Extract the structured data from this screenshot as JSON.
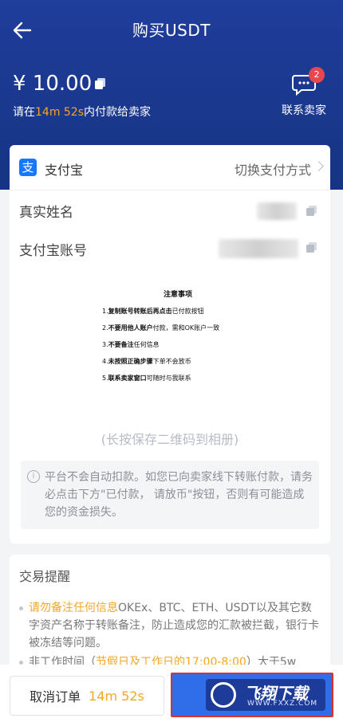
{
  "header": {
    "title": "购买USDT",
    "price": "¥ 10.00",
    "pay_tip_prefix": "请在",
    "pay_tip_time": "14m 52s",
    "pay_tip_suffix": "内付款给卖家",
    "contact_label": "联系卖家",
    "contact_badge": "2"
  },
  "payment": {
    "method_icon_text": "支",
    "method": "支付宝",
    "switch_label": "切换支付方式",
    "rows": [
      {
        "label": "真实姓名"
      },
      {
        "label": "支付宝账号"
      }
    ],
    "notice": {
      "title": "注意事项",
      "items": [
        {
          "num": "1.",
          "bold": "复制账号转账后再点击",
          "rest": "已付款按钮"
        },
        {
          "num": "2.",
          "bold": "不要用他人账户",
          "rest": "付款，需和OK账户一致"
        },
        {
          "num": "3.",
          "bold": "不要备注",
          "rest": "任何信息"
        },
        {
          "num": "4.",
          "bold": "未按照正确步骤",
          "rest": "下单不会放币"
        },
        {
          "num": "5.",
          "bold": "联系卖家窗口",
          "rest": "可随时与我联系"
        }
      ]
    },
    "save_qr": "(长按保存二维码到相册)",
    "warning": "平台不会自动扣款。如您已向卖家线下转账付款，请务必点击下方\"已付款， 请放币\"按钮，否则有可能造成您的资金损失。"
  },
  "tips": {
    "title": "交易提醒",
    "item1_highlight": "请勿备注任何信息",
    "item1_text": "OKEx、BTC、ETH、USDT以及其它数字资产名称于转账备注，防止造成您的汇款被拦截，银行卡被冻结等问题。",
    "item2_prefix": "非工作时间（",
    "item2_highlight": "节假日及工作日的17:00-8:00",
    "item2_suffix": "）大于5w"
  },
  "bottom": {
    "cancel_label": "取消订单",
    "cancel_time": "14m 52s",
    "watermark_title": "飞翔下载",
    "watermark_url": "WWW.FXXZ.COM"
  }
}
